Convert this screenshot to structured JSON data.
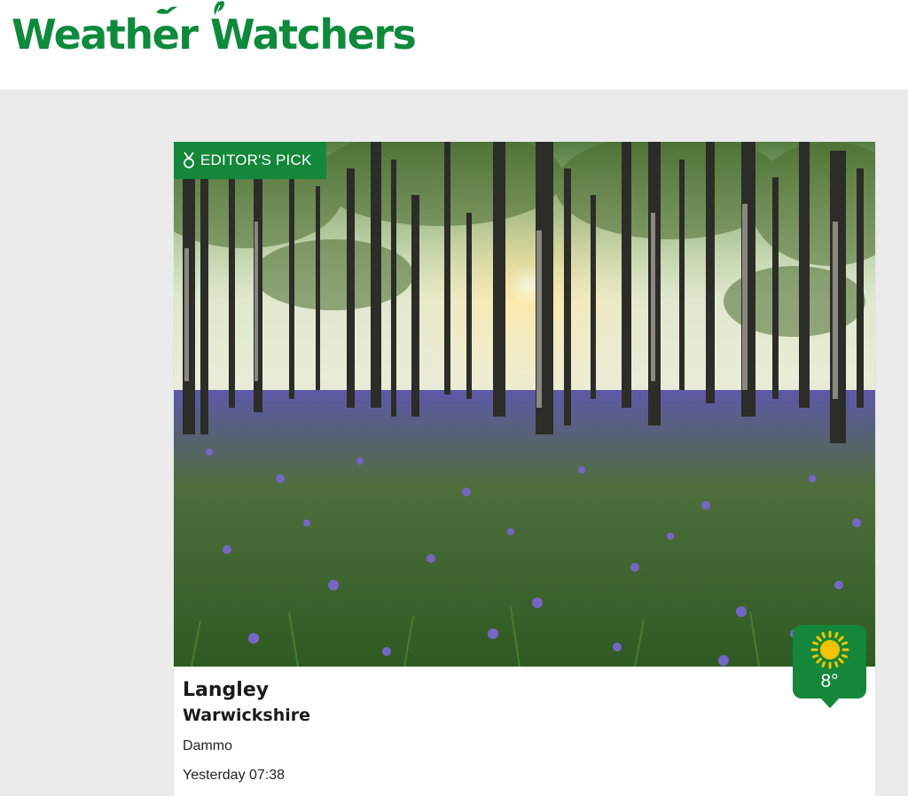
{
  "header": {
    "logo_text": "Weather Watchers",
    "brand_color": "#0f8a3c"
  },
  "card": {
    "badge_icon": "medal-icon",
    "badge_label": "EDITOR'S PICK",
    "photo_subject": "bluebell woodland with sunlight through trees",
    "weather_icon": "sun-icon",
    "temperature": "8°",
    "location": "Langley",
    "region": "Warwickshire",
    "author": "Dammo",
    "time": "Yesterday 07:38"
  }
}
